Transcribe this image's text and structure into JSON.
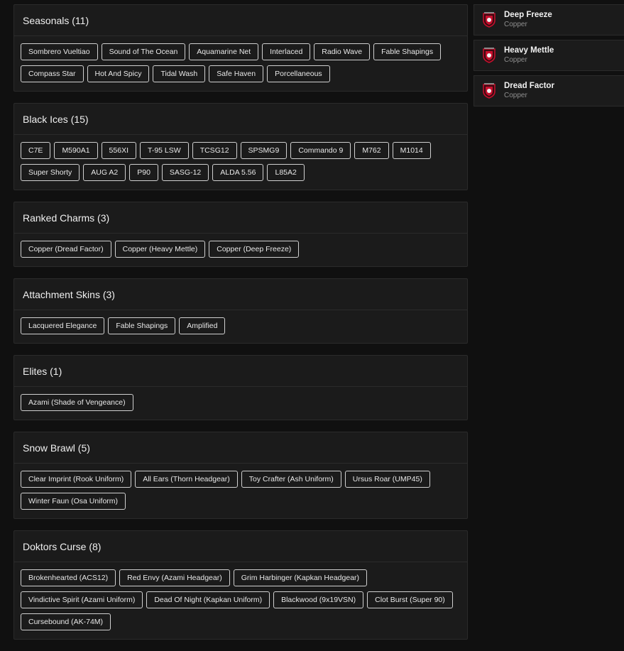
{
  "categories": [
    {
      "title": "Seasonals (11)",
      "items": [
        "Sombrero Vueltiao",
        "Sound of The Ocean",
        "Aquamarine Net",
        "Interlaced",
        "Radio Wave",
        "Fable Shapings",
        "Compass Star",
        "Hot And Spicy",
        "Tidal Wash",
        "Safe Haven",
        "Porcellaneous"
      ]
    },
    {
      "title": "Black Ices (15)",
      "items": [
        "C7E",
        "M590A1",
        "556XI",
        "T-95 LSW",
        "TCSG12",
        "SPSMG9",
        "Commando 9",
        "M762",
        "M1014",
        "Super Shorty",
        "AUG A2",
        "P90",
        "SASG-12",
        "ALDA 5.56",
        "L85A2"
      ]
    },
    {
      "title": "Ranked Charms (3)",
      "items": [
        "Copper (Dread Factor)",
        "Copper (Heavy Mettle)",
        "Copper (Deep Freeze)"
      ]
    },
    {
      "title": "Attachment Skins (3)",
      "items": [
        "Lacquered Elegance",
        "Fable Shapings",
        "Amplified"
      ]
    },
    {
      "title": "Elites (1)",
      "items": [
        "Azami (Shade of Vengeance)"
      ]
    },
    {
      "title": "Snow Brawl (5)",
      "items": [
        "Clear Imprint (Rook Uniform)",
        "All Ears (Thorn Headgear)",
        "Toy Crafter (Ash Uniform)",
        "Ursus Roar (UMP45)",
        "Winter Faun (Osa Uniform)"
      ]
    },
    {
      "title": "Doktors Curse (8)",
      "items": [
        "Brokenhearted (ACS12)",
        "Red Envy (Azami Headgear)",
        "Grim Harbinger (Kapkan Headgear)",
        "Vindictive Spirit (Azami Uniform)",
        "Dead Of Night (Kapkan Uniform)",
        "Blackwood (9x19VSN)",
        "Clot Burst (Super 90)",
        "Cursebound (AK-74M)"
      ]
    }
  ],
  "charms": [
    {
      "name": "Deep Freeze",
      "rank": "Copper",
      "icon": "copper-rank-charm-icon"
    },
    {
      "name": "Heavy Mettle",
      "rank": "Copper",
      "icon": "copper-rank-charm-icon"
    },
    {
      "name": "Dread Factor",
      "rank": "Copper",
      "icon": "copper-rank-charm-icon"
    }
  ],
  "colors": {
    "background": "#101010",
    "panel": "#1b1b1b",
    "border": "#2b2b2b",
    "chip_border": "#d0d0d0",
    "charm_red": "#c8102e"
  }
}
